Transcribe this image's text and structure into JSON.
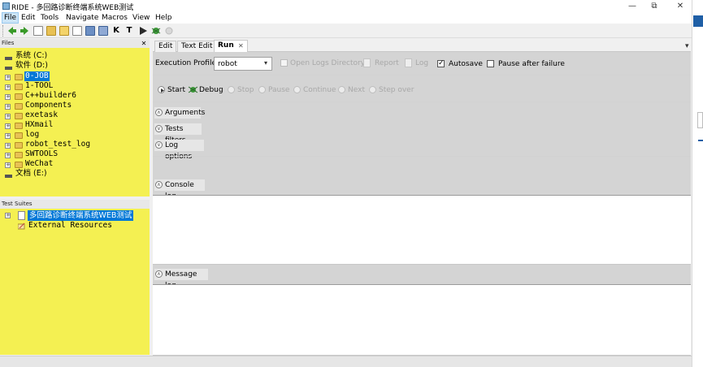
{
  "window": {
    "title": "RIDE - 多回路诊断终端系统WEB测试",
    "minimize_glyph": "—",
    "restore_glyph": "⧉",
    "close_glyph": "✕"
  },
  "menu": [
    "File",
    "Edit",
    "Tools",
    "Navigate",
    "Macros",
    "View",
    "Help"
  ],
  "toolbar_icons": [
    "back-arrow-icon",
    "forward-arrow-icon",
    "new-project-icon",
    "open-folder-icon",
    "open-directory-icon",
    "new-file-icon",
    "save-icon",
    "save-all-icon",
    "search-keywords-icon",
    "search-tests-icon",
    "run-icon",
    "bug-icon",
    "stop-icon"
  ],
  "files_panel": {
    "title": "Files",
    "close_glyph": "✕",
    "drives": [
      {
        "label": "系统 (C:)"
      },
      {
        "label": "软件 (D:)"
      }
    ],
    "folders": [
      "0-JOB",
      "1-TOOL",
      "C++builder6",
      "Components",
      "exetask",
      "HXmail",
      "log",
      "robot_test_log",
      "SWTOOLS",
      "WeChat"
    ],
    "last_drive": "文档 (E:)",
    "selected_folder": "0-JOB"
  },
  "suites_panel": {
    "title": "Test Suites",
    "suite": "多回路诊断终端系统WEB测试",
    "external": "External Resources"
  },
  "tabs": [
    {
      "label": "Edit",
      "active": false
    },
    {
      "label": "Text Edit",
      "active": false
    },
    {
      "label": "Run",
      "active": true
    }
  ],
  "tab_close_glyph": "✕",
  "tab_dropdown_glyph": "▾",
  "run": {
    "profile_label": "Execution Profile:",
    "profile_value": "robot",
    "open_logs_dir": "Open Logs Directory",
    "report": "Report",
    "log": "Log",
    "autosave": "Autosave",
    "autosave_checked": true,
    "pause_after_failure": "Pause after failure",
    "pause_checked": false,
    "buttons": [
      {
        "label": "Start",
        "enabled": true
      },
      {
        "label": "Debug",
        "enabled": true
      },
      {
        "label": "Stop",
        "enabled": false
      },
      {
        "label": "Pause",
        "enabled": false
      },
      {
        "label": "Continue",
        "enabled": false
      },
      {
        "label": "Next",
        "enabled": false
      },
      {
        "label": "Step over",
        "enabled": false
      }
    ],
    "sections": [
      "Arguments",
      "Tests filters",
      "Log options"
    ],
    "console_log": "Console log",
    "message_log": "Message log"
  },
  "colors": {
    "tree_background": "#f4f052",
    "selection": "#0078d7",
    "accent_blue": "#1f5fa6"
  }
}
